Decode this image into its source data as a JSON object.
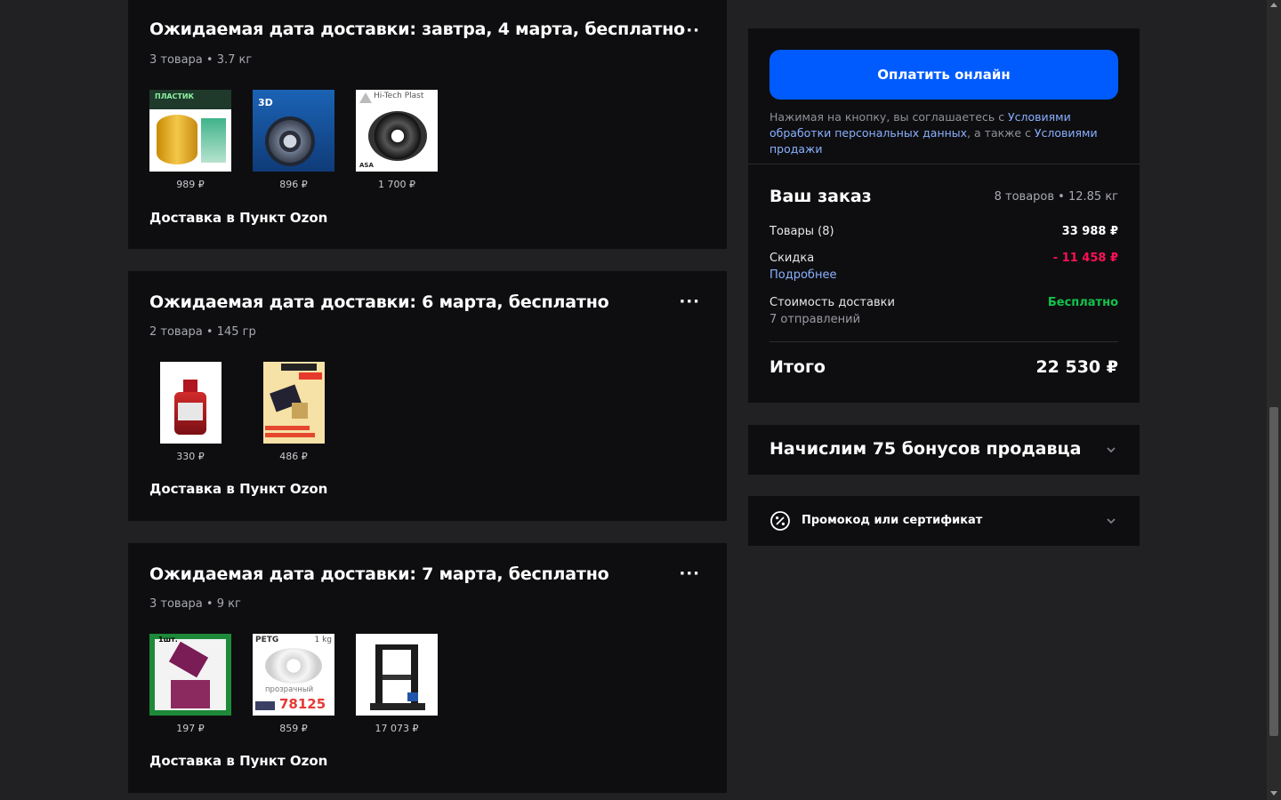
{
  "shipments": [
    {
      "title": "Ожидаемая дата доставки: завтра, 4 марта, бесплатно",
      "meta": "3 товара • 3.7 кг",
      "delivery": "Доставка в Пункт Ozon",
      "items": [
        {
          "price": "989 ₽",
          "image": "yellow-filament-spool",
          "label": "ПЛАСТИК"
        },
        {
          "price": "896 ₽",
          "image": "blue-filament-box",
          "label": "3D"
        },
        {
          "price": "1 700 ₽",
          "image": "black-filament-spool",
          "label": "Hi-Tech Plast",
          "sublabel": "ASA"
        }
      ]
    },
    {
      "title": "Ожидаемая дата доставки: 6 марта, бесплатно",
      "meta": "2 товара • 145 гр",
      "delivery": "Доставка в Пункт Ozon",
      "items": [
        {
          "price": "330 ₽",
          "image": "red-liquid-bottle"
        },
        {
          "price": "486 ₽",
          "image": "gps-module-box"
        }
      ]
    },
    {
      "title": "Ожидаемая дата доставки: 7 марта, бесплатно",
      "meta": "3 товара • 9 кг",
      "delivery": "Доставка в Пункт Ozon",
      "items": [
        {
          "price": "197 ₽",
          "image": "sensor-board",
          "label": "1шт."
        },
        {
          "price": "859 ₽",
          "image": "petg-filament",
          "label": "PETG",
          "sublabel": "1 kg",
          "note": "прозрачный",
          "code": "78125"
        },
        {
          "price": "17 073 ₽",
          "image": "3d-printer"
        }
      ]
    }
  ],
  "checkout": {
    "pay_button": "Оплатить онлайн",
    "agree_prefix": "Нажимая на кнопку, вы соглашаетесь с ",
    "agree_link1": "Условиями обработки персональных данных",
    "agree_middle": ", а также с ",
    "agree_link2": "Условиями продажи",
    "order_title": "Ваш заказ",
    "order_meta": "8 товаров • 12.85 кг",
    "goods_label": "Товары (8)",
    "goods_value": "33 988 ₽",
    "discount_label": "Скидка",
    "discount_value": "- 11 458 ₽",
    "discount_link": "Подробнее",
    "delivery_cost_label": "Стоимость доставки",
    "delivery_cost_value": "Бесплатно",
    "shipments_count": "7 отправлений",
    "total_label": "Итого",
    "total_value": "22 530 ₽"
  },
  "bonus": {
    "title": "Начислим 75 бонусов продавца"
  },
  "promo": {
    "label": "Промокод или сертификат",
    "icon": "percent-badge-icon"
  },
  "colors": {
    "accent": "#005bff",
    "discount": "#f91155",
    "free": "#10c44c",
    "link": "#8ab0ff"
  }
}
